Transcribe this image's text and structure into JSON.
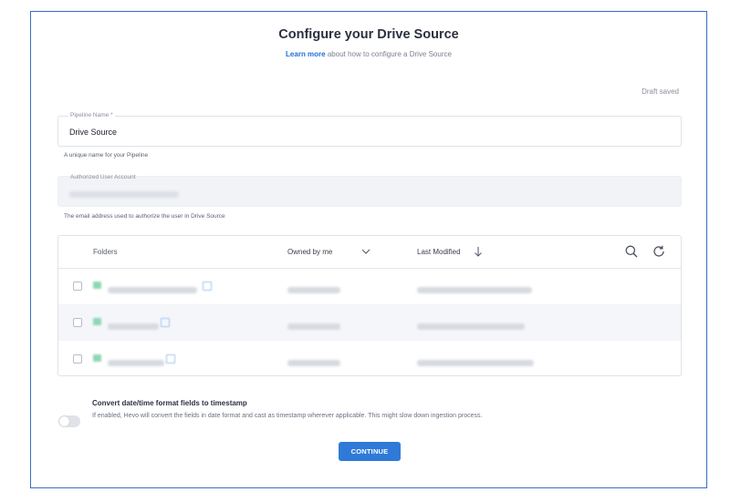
{
  "header": {
    "title": "Configure your Drive Source",
    "learn_more": "Learn more",
    "subtitle_rest": " about how to configure a Drive Source"
  },
  "status": {
    "draft": "Draft saved"
  },
  "pipeline_name": {
    "label": "Pipeline Name *",
    "value": "Drive Source",
    "help": "A unique name for your Pipeline"
  },
  "user_account": {
    "label": "Authorized User Account",
    "value_blurred": true,
    "help": "The email address used to authorize the user in Drive Source"
  },
  "table": {
    "columns": {
      "folders": "Folders",
      "owned": "Owned by me",
      "modified": "Last Modified"
    },
    "rows": [
      {
        "checked": false,
        "name_blurred": true,
        "owner_blurred": true,
        "modified_blurred": true
      },
      {
        "checked": false,
        "name_blurred": true,
        "owner_blurred": true,
        "modified_blurred": true
      },
      {
        "checked": false,
        "name_blurred": true,
        "owner_blurred": true,
        "modified_blurred": true
      }
    ]
  },
  "timestamp_toggle": {
    "enabled": false,
    "label": "Convert date/time format fields to timestamp",
    "description": "If enabled, Hevo will convert the fields in date format and cast as timestamp wherever applicable. This might slow down ingestion process."
  },
  "actions": {
    "continue": "CONTINUE"
  },
  "icons": {
    "owned_dropdown": "chevron-down-icon",
    "sort": "arrow-down-icon",
    "search": "search-icon",
    "refresh": "refresh-icon",
    "folder": "folder-icon",
    "external_link": "external-link-icon"
  },
  "colors": {
    "accent": "#2f7ad8",
    "frame_border": "#3a6fc4",
    "row_alt": "#f5f6f9",
    "folder_icon": "#8fd7b4"
  }
}
